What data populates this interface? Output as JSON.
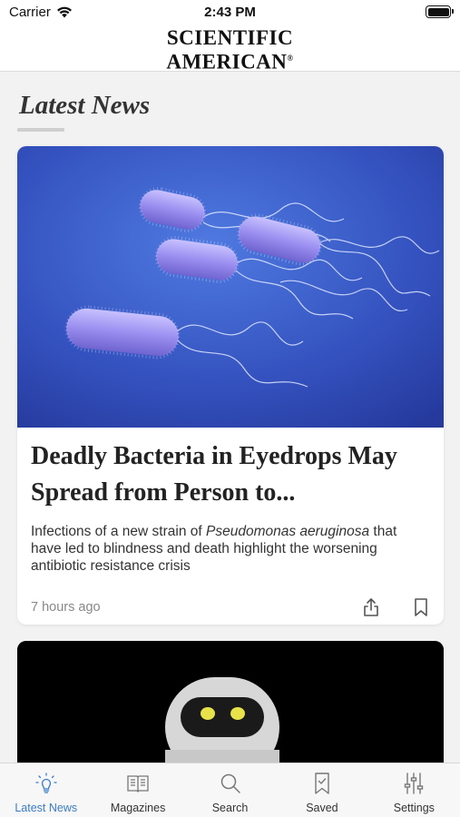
{
  "status_bar": {
    "carrier": "Carrier",
    "time": "2:43 PM"
  },
  "brand": {
    "line1": "SCIENTIFIC",
    "line2": "AMERICAN",
    "registered_mark": "®"
  },
  "section": {
    "title": "Latest News"
  },
  "articles": [
    {
      "title": "Deadly Bacteria in Eyedrops May Spread from Person to...",
      "summary_before": "Infections of a new strain of ",
      "summary_italic": "Pseudomonas aeruginosa",
      "summary_after": " that have led to blindness and death highlight the worsening antibiotic resistance crisis",
      "timestamp": "7 hours ago",
      "image": "bacteria-illustration"
    },
    {
      "image": "robot-illustration"
    }
  ],
  "tab_bar": {
    "items": [
      {
        "label": "Latest News",
        "icon": "lightbulb-icon",
        "active": true
      },
      {
        "label": "Magazines",
        "icon": "magazine-icon",
        "active": false
      },
      {
        "label": "Search",
        "icon": "search-icon",
        "active": false
      },
      {
        "label": "Saved",
        "icon": "bookmark-icon",
        "active": false
      },
      {
        "label": "Settings",
        "icon": "sliders-icon",
        "active": false
      }
    ]
  },
  "colors": {
    "accent": "#3a7dc9",
    "background": "#f2f2f2",
    "card": "#ffffff",
    "image_blue": "#3f5fc8",
    "bacteria_purple": "#9b8ff0"
  }
}
